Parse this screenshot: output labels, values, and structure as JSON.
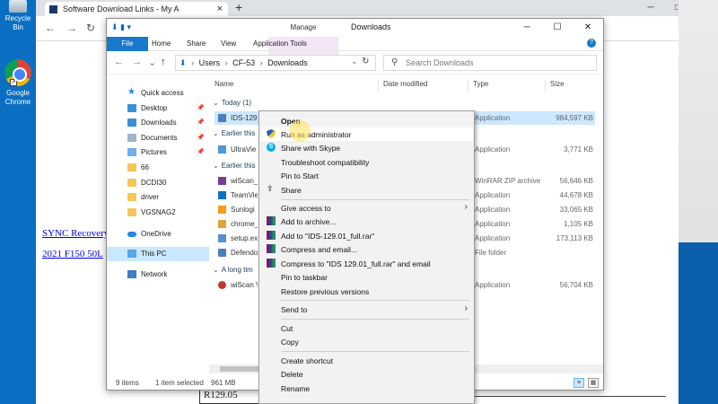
{
  "desktop": {
    "recycle_bin": "Recycle Bin",
    "chrome_line1": "Google",
    "chrome_line2": "Chrome"
  },
  "browser": {
    "tab_title": "Software Download Links - My A",
    "links": [
      "SYNC Recovery",
      "2021 F150 50L"
    ],
    "price_cell": "R129.05"
  },
  "explorer": {
    "title": "Downloads",
    "ribbon_context": "Manage",
    "ribbon_tabs": [
      "File",
      "Home",
      "Share",
      "View",
      "Application Tools"
    ],
    "address": {
      "crumbs": [
        "Users",
        "CF-53",
        "Downloads"
      ],
      "search_placeholder": "Search Downloads"
    },
    "nav": {
      "items": [
        {
          "label": "Quick access",
          "pinned": false
        },
        {
          "label": "Desktop",
          "pinned": true
        },
        {
          "label": "Downloads",
          "pinned": true
        },
        {
          "label": "Documents",
          "pinned": true
        },
        {
          "label": "Pictures",
          "pinned": true
        },
        {
          "label": "66",
          "pinned": false
        },
        {
          "label": "DCDI30",
          "pinned": false
        },
        {
          "label": "driver",
          "pinned": false
        },
        {
          "label": "VGSNAG2",
          "pinned": false
        },
        {
          "label": "OneDrive",
          "pinned": false
        },
        {
          "label": "This PC",
          "pinned": false
        },
        {
          "label": "Network",
          "pinned": false
        }
      ]
    },
    "columns": [
      "Name",
      "Date modified",
      "Type",
      "Size"
    ],
    "groups": [
      "Today (1)",
      "Earlier this",
      "Earlier this",
      "A long tim"
    ],
    "files": [
      {
        "name": "IDS-129",
        "type": "Application",
        "size": "984,597 KB",
        "selected": true
      },
      {
        "name": "UltraVie",
        "type": "Application",
        "size": "3,771 KB",
        "selected": false
      },
      {
        "name": "wiScan_",
        "type": "WinRAR ZIP archive",
        "size": "56,646 KB",
        "selected": false
      },
      {
        "name": "TeamVie",
        "type": "Application",
        "size": "44,678 KB",
        "selected": false
      },
      {
        "name": "Sunlogi",
        "type": "Application",
        "size": "33,065 KB",
        "selected": false
      },
      {
        "name": "chrome_",
        "type": "Application",
        "size": "1,105 KB",
        "selected": false
      },
      {
        "name": "setup.ex",
        "type": "Application",
        "size": "173,113 KB",
        "selected": false
      },
      {
        "name": "Defendo",
        "type": "File folder",
        "size": "",
        "selected": false
      },
      {
        "name": "wiScan V",
        "type": "Application",
        "size": "56,704 KB",
        "selected": false
      }
    ],
    "status": {
      "count": "9 items",
      "selected": "1 item selected",
      "size": "961 MB"
    }
  },
  "context_menu": {
    "items": [
      {
        "label": "Open",
        "bold": true
      },
      {
        "label": "Run as administrator",
        "icon": "shield-icon"
      },
      {
        "label": "Share with Skype",
        "icon": "skype-icon"
      },
      {
        "label": "Troubleshoot compatibility"
      },
      {
        "label": "Pin to Start"
      },
      {
        "label": "Share",
        "icon": "share-icon"
      },
      {
        "label": "Give access to",
        "submenu": true
      },
      {
        "label": "Add to archive...",
        "icon": "winrar-icon"
      },
      {
        "label": "Add to \"IDS-129.01_full.rar\"",
        "icon": "winrar-icon"
      },
      {
        "label": "Compress and email...",
        "icon": "winrar-icon"
      },
      {
        "label": "Compress to \"IDS 129.01_full.rar\" and email",
        "icon": "winrar-icon"
      },
      {
        "label": "Pin to taskbar"
      },
      {
        "label": "Restore previous versions"
      },
      {
        "label": "Send to",
        "submenu": true
      },
      {
        "label": "Cut"
      },
      {
        "label": "Copy"
      },
      {
        "label": "Create shortcut"
      },
      {
        "label": "Delete"
      },
      {
        "label": "Rename"
      }
    ]
  }
}
